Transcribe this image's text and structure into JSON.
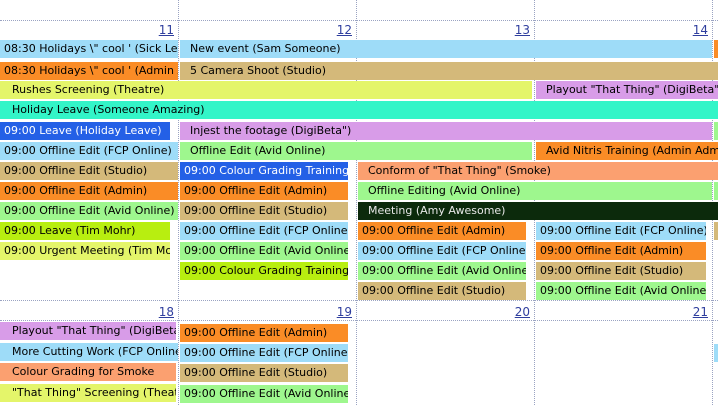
{
  "calendar": {
    "day_numbers": {
      "d11": "11",
      "d12": "12",
      "d13": "13",
      "d14": "14",
      "d18": "18",
      "d19": "19",
      "d20": "20",
      "d21": "21"
    },
    "colors": {
      "blue_light": "#9edcf8",
      "tan": "#d4b97a",
      "orange": "#fa8c26",
      "yellow_green": "#e4f56a",
      "lavender": "#d89ce8",
      "aqua": "#33f5c8",
      "blue_dark": "#2460e6",
      "light_green": "#9ef78e",
      "lime": "#b8ee10",
      "salmon": "#fba070",
      "dark_green": "#0c2a0c"
    },
    "week1": {
      "holidays_sick": "08:30 Holidays \\\" cool ' (Sick Leave)",
      "holidays_admin": "08:30 Holidays \\\" cool ' (Admin Admin)",
      "new_event": "New event (Sam Someone)",
      "camera_shoot": "5 Camera Shoot (Studio)",
      "rushes_screening": "Rushes Screening (Theatre)",
      "playout_14": "Playout \"That Thing\" (DigiBeta\")",
      "holiday_leave": "Holiday Leave (Someone Amazing)",
      "leave_holiday": "09:00 Leave (Holiday Leave)",
      "injest": "Injest the footage (DigiBeta\")",
      "offline_fcp_11": "09:00 Offline Edit (FCP Online)",
      "offline_avid_12": "Offline Edit (Avid Online)",
      "avid_nitris": "Avid Nitris Training (Admin Admin)",
      "offline_studio_11": "09:00 Offline Edit (Studio)",
      "colour_grading_training_12": "09:00 Colour Grading Training (Ho",
      "conform": "Conform of \"That Thing\" (Smoke)",
      "offline_admin_11": "09:00 Offline Edit (Admin)",
      "offline_admin_12": "09:00 Offline Edit (Admin)",
      "offline_editing_avid": "Offline Editing (Avid Online)",
      "offline_avid_11": "09:00 Offline Edit (Avid Online)",
      "offline_studio_12": "09:00 Offline Edit (Studio)",
      "meeting": "Meeting (Amy Awesome)",
      "leave_tim": "09:00 Leave (Tim Mohr)",
      "offline_fcp_12": "09:00 Offline Edit (FCP Online)",
      "offline_admin_13": "09:00 Offline Edit (Admin)",
      "offline_fcp_14": "09:00 Offline Edit (FCP Online)",
      "urgent_meeting": "09:00 Urgent Meeting (Tim Mohr)",
      "offline_avid_12b": "09:00 Offline Edit (Avid Online)",
      "offline_fcp_13": "09:00 Offline Edit (FCP Online)",
      "offline_admin_14": "09:00 Offline Edit (Admin)",
      "colour_grading_training_12b": "09:00 Colour Grading Training (Tim",
      "offline_avid_13": "09:00 Offline Edit (Avid Online)",
      "offline_studio_14": "09:00 Offline Edit (Studio)",
      "offline_studio_13": "09:00 Offline Edit (Studio)",
      "offline_avid_14": "09:00 Offline Edit (Avid Online)"
    },
    "week2": {
      "playout_18": "Playout \"That Thing\" (DigiBeta\")",
      "offline_admin_19": "09:00 Offline Edit (Admin)",
      "more_cutting": "More Cutting Work (FCP Online)",
      "offline_fcp_19": "09:00 Offline Edit (FCP Online)",
      "colour_grading_smoke": "Colour Grading for Smoke",
      "offline_studio_19": "09:00 Offline Edit (Studio)",
      "that_thing_screening": "\"That Thing\" Screening (Theatre)",
      "offline_avid_19": "09:00 Offline Edit (Avid Online)"
    }
  }
}
